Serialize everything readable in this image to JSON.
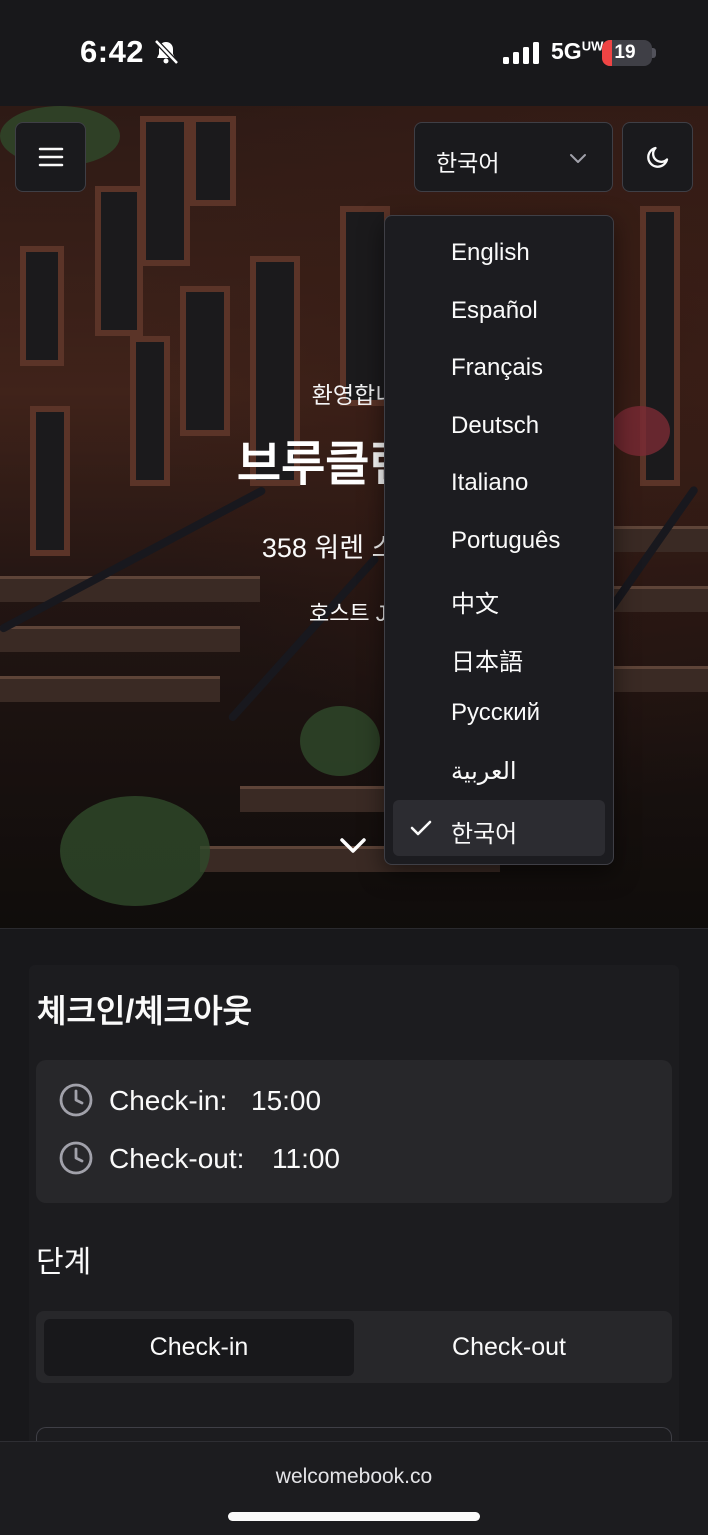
{
  "status_bar": {
    "time": "6:42",
    "network": "5G",
    "network_suffix": "UW",
    "battery_percent": 19,
    "battery_label": "19",
    "battery_color": "#ef4444"
  },
  "header": {
    "menu_icon": "hamburger-icon",
    "language_selected": "한국어",
    "theme_icon": "moon-icon"
  },
  "language_menu": {
    "options": [
      {
        "label": "English",
        "selected": false
      },
      {
        "label": "Español",
        "selected": false
      },
      {
        "label": "Français",
        "selected": false
      },
      {
        "label": "Deutsch",
        "selected": false
      },
      {
        "label": "Italiano",
        "selected": false
      },
      {
        "label": "Português",
        "selected": false
      },
      {
        "label": "中文",
        "selected": false
      },
      {
        "label": "日本語",
        "selected": false
      },
      {
        "label": "Русский",
        "selected": false
      },
      {
        "label": "العربية",
        "selected": false
      },
      {
        "label": "한국어",
        "selected": true
      }
    ]
  },
  "hero": {
    "welcome": "환영합니",
    "title": "브루클린 브",
    "address": "358 워렌 스트리",
    "host": "호스트 Ju"
  },
  "checkin_section": {
    "title": "체크인/체크아웃",
    "checkin_label": "Check-in:",
    "checkin_time": "15:00",
    "checkout_label": "Check-out:",
    "checkout_time": "11:00"
  },
  "steps_section": {
    "title": "단계",
    "tabs": [
      {
        "label": "Check-in",
        "active": true
      },
      {
        "label": "Check-out",
        "active": false
      }
    ]
  },
  "browser": {
    "url": "welcomebook.co"
  }
}
